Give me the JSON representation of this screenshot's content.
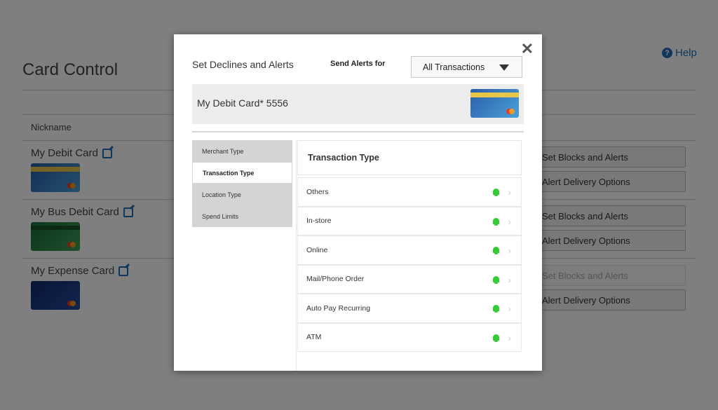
{
  "background": {
    "title": "Card Control",
    "help_label": "Help",
    "nickname_header": "Nickname",
    "cards": [
      {
        "name": "My Debit Card",
        "style": "blue"
      },
      {
        "name": "My Bus Debit Card",
        "style": "green"
      },
      {
        "name": "My Expense Card",
        "style": "navy"
      }
    ],
    "actions": {
      "set_blocks": "Set Blocks and Alerts",
      "alert_delivery": "Alert Delivery Options"
    }
  },
  "modal": {
    "title": "Set Declines and Alerts",
    "send_alerts_label": "Send Alerts for",
    "send_alerts_value": "All Transactions",
    "card_label": "My Debit Card* 5556",
    "nav": [
      {
        "label": "Merchant Type",
        "active": false
      },
      {
        "label": "Transaction Type",
        "active": true
      },
      {
        "label": "Location Type",
        "active": false
      },
      {
        "label": "Spend Limits",
        "active": false
      }
    ],
    "panel_title": "Transaction Type",
    "rows": [
      "Others",
      "In-store",
      "Online",
      "Mail/Phone Order",
      "Auto Pay Recurring",
      "ATM"
    ],
    "colors": {
      "bell": "#33cc33",
      "link": "#1f6fb6"
    },
    "icons": {
      "close": "close-icon",
      "bell": "bell-icon",
      "chevron": "chevron-right-icon"
    }
  }
}
